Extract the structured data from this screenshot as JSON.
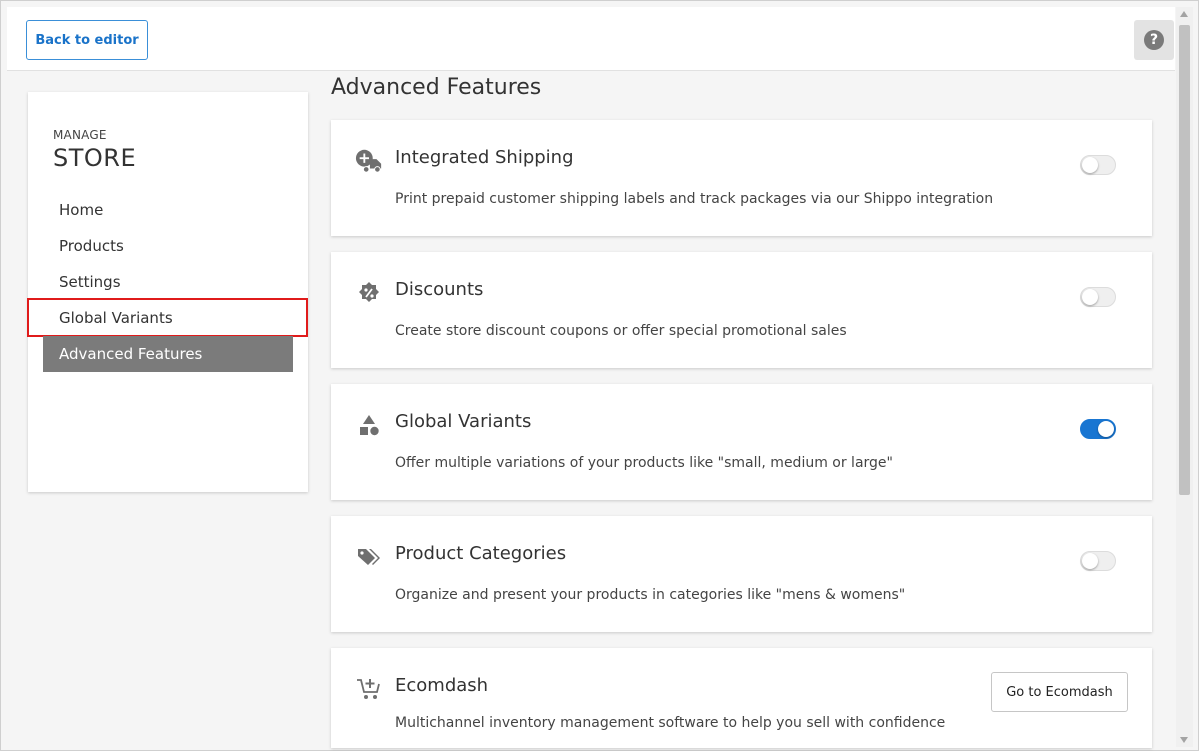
{
  "topbar": {
    "back_label": "Back to editor",
    "help_label": "?"
  },
  "sidebar": {
    "manage_label": "MANAGE",
    "store_label": "STORE",
    "items": [
      {
        "label": "Home"
      },
      {
        "label": "Products"
      },
      {
        "label": "Settings"
      },
      {
        "label": "Global Variants"
      },
      {
        "label": "Advanced Features"
      }
    ],
    "active_item": "Advanced Features",
    "highlighted_item": "Global Variants"
  },
  "main": {
    "title": "Advanced Features",
    "features": [
      {
        "title": "Integrated Shipping",
        "description": "Print prepaid customer shipping labels and track packages via our Shippo integration",
        "icon": "shipping-truck-icon",
        "enabled": false
      },
      {
        "title": "Discounts",
        "description": "Create store discount coupons or offer special promotional sales",
        "icon": "discount-badge-icon",
        "enabled": false
      },
      {
        "title": "Global Variants",
        "description": "Offer multiple variations of your products like \"small, medium or large\"",
        "icon": "shapes-icon",
        "enabled": true
      },
      {
        "title": "Product Categories",
        "description": "Organize and present your products in categories like \"mens & womens\"",
        "icon": "tags-icon",
        "enabled": false
      },
      {
        "title": "Ecomdash",
        "description": "Multichannel inventory management software to help you sell with confidence",
        "icon": "cart-plus-icon",
        "button_label": "Go to Ecomdash"
      }
    ]
  },
  "colors": {
    "accent": "#1976d2",
    "active_nav": "#7b7b7b",
    "highlight_outline": "#e01b1b"
  }
}
